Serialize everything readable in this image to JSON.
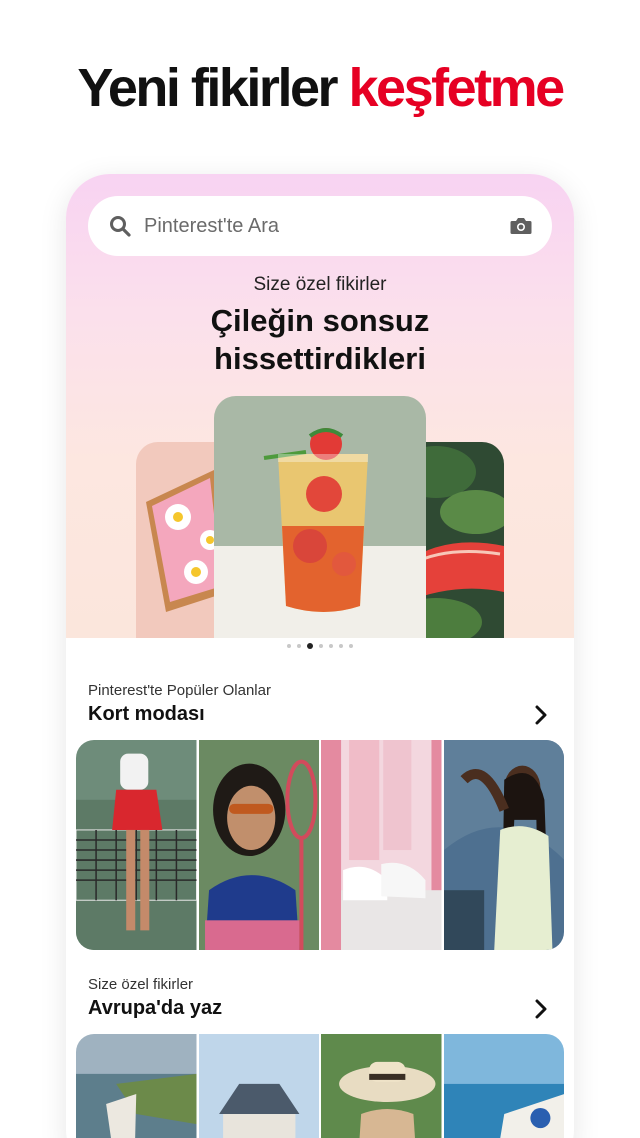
{
  "headline": {
    "part1": "Yeni fikirler",
    "part2": "keşfetme"
  },
  "search": {
    "placeholder": "Pinterest'te Ara"
  },
  "hero": {
    "subtitle": "Size özel fikirler",
    "title_line1": "Çileğin sonsuz",
    "title_line2": "hissettirdikleri"
  },
  "carousel": {
    "dot_count": 7,
    "active_index": 2
  },
  "sections": [
    {
      "subtitle": "Pinterest'te Popüler Olanlar",
      "title": "Kort modası"
    },
    {
      "subtitle": "Size özel fikirler",
      "title": "Avrupa'da yaz"
    }
  ],
  "colors": {
    "accent": "#e60023",
    "hero_top": "#f8d3f2",
    "hero_bottom": "#fbe6dc"
  },
  "icons": {
    "search": "search-icon",
    "camera": "camera-icon",
    "chevron": "chevron-right-icon"
  }
}
